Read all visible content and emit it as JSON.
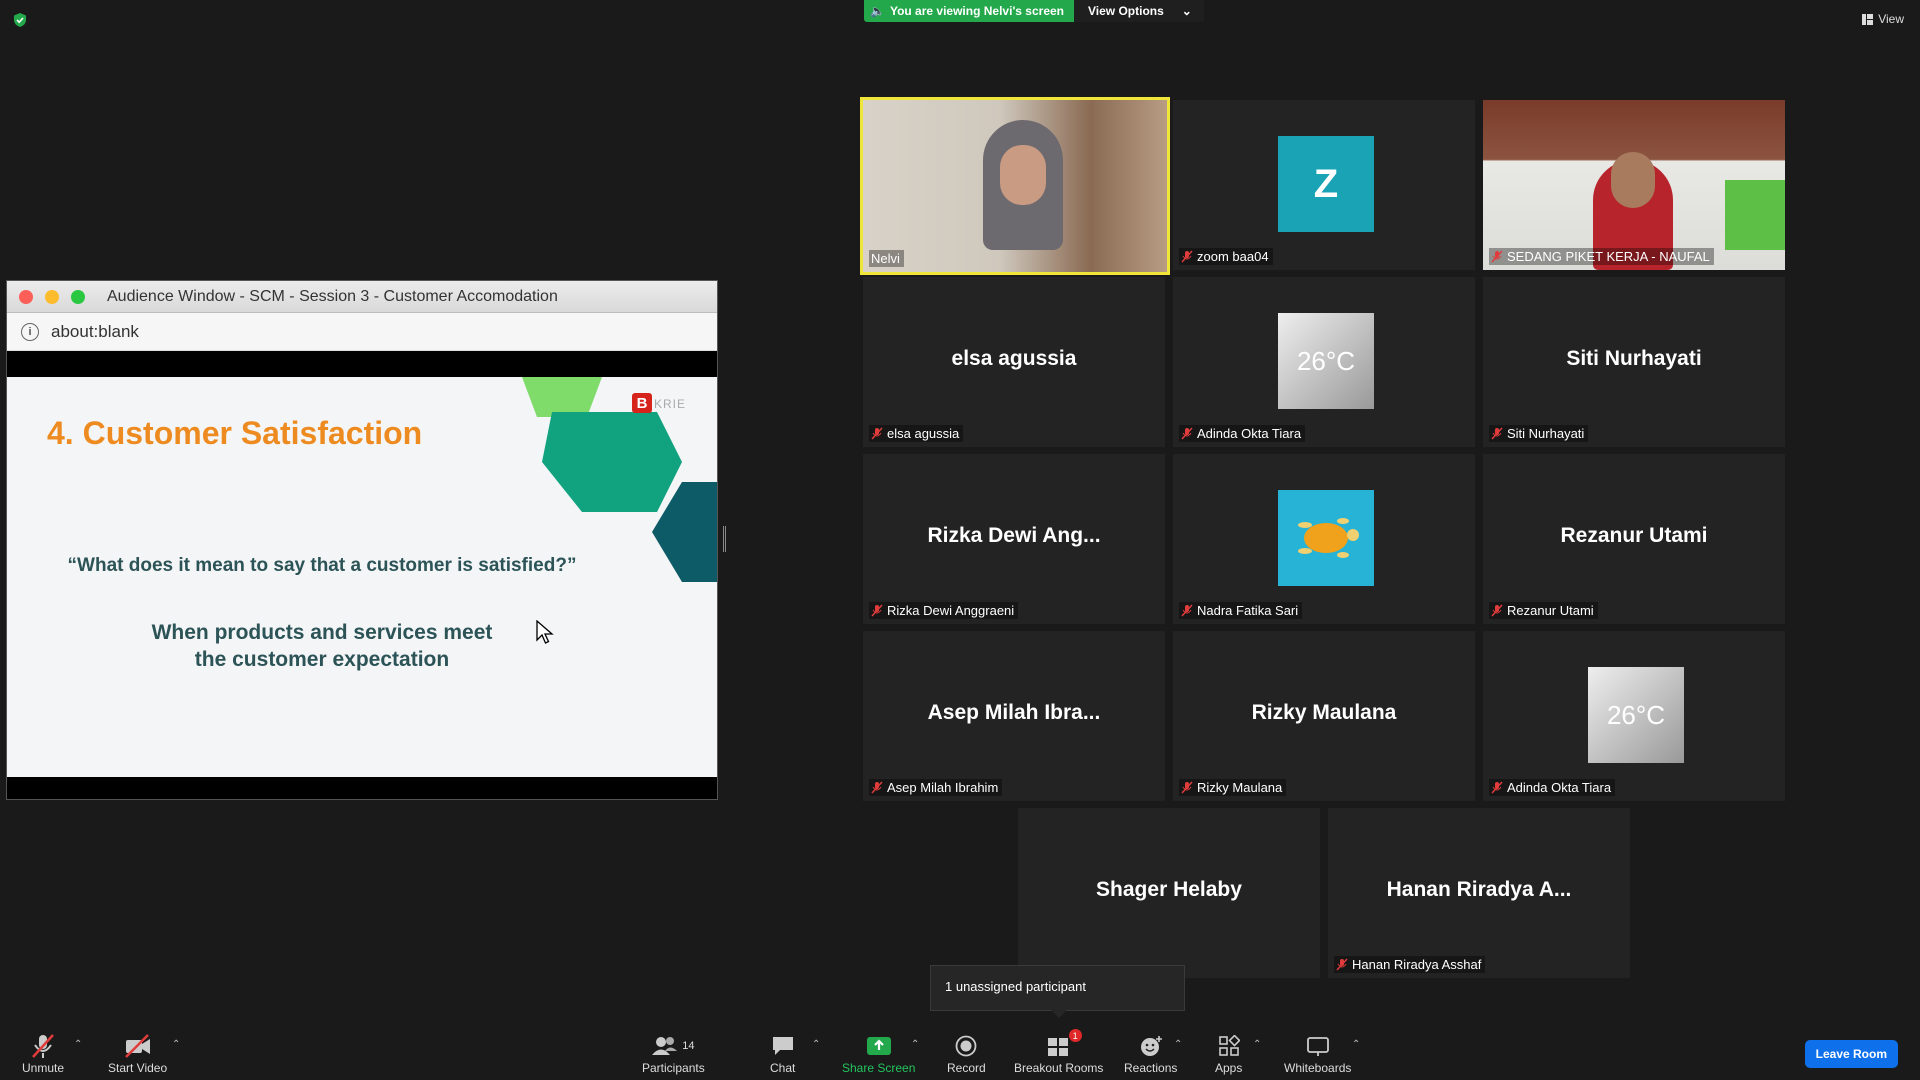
{
  "banner": {
    "viewing": "You are viewing Nelvi's screen",
    "options": "View Options"
  },
  "view_button": "View",
  "audience": {
    "title": "Audience Window - SCM - Session 3 - Customer Accomodation",
    "url": "about:blank",
    "slide": {
      "heading": "4. Customer Satisfaction",
      "question": "“What does it mean to say that a customer is satisfied?”",
      "answer_line1": "When products and services meet",
      "answer_line2": "the customer expectation",
      "logo_text": "KRIE"
    }
  },
  "tiles": [
    {
      "name": "Nelvi",
      "display": ""
    },
    {
      "name": "zoom baa04",
      "display": ""
    },
    {
      "name": "SEDANG PIKET KERJA - NAUFAL",
      "display": ""
    },
    {
      "name": "elsa agussia",
      "display": "elsa agussia"
    },
    {
      "name": "Adinda Okta Tiara",
      "display": ""
    },
    {
      "name": "Siti Nurhayati",
      "display": "Siti Nurhayati"
    },
    {
      "name": "Rizka Dewi Anggraeni",
      "display": "Rizka Dewi Ang..."
    },
    {
      "name": "Nadra Fatika Sari",
      "display": ""
    },
    {
      "name": "Rezanur Utami",
      "display": "Rezanur Utami"
    },
    {
      "name": "Asep Milah Ibrahim",
      "display": "Asep Milah Ibra..."
    },
    {
      "name": "Rizky Maulana",
      "display": "Rizky Maulana"
    },
    {
      "name": "Adinda Okta Tiara",
      "display": ""
    },
    {
      "name": "",
      "display": "Shager Helaby"
    },
    {
      "name": "Hanan Riradya Asshaf",
      "display": "Hanan Riradya A..."
    }
  ],
  "avatars": {
    "zoom_letter": "Z",
    "weather_text": "26°C"
  },
  "tooltip": "1 unassigned participant",
  "toolbar": {
    "unmute": "Unmute",
    "start_video": "Start Video",
    "participants": "Participants",
    "participant_count": "14",
    "chat": "Chat",
    "share_screen": "Share Screen",
    "record": "Record",
    "breakout": "Breakout Rooms",
    "breakout_badge": "1",
    "reactions": "Reactions",
    "apps": "Apps",
    "whiteboards": "Whiteboards",
    "leave": "Leave Room"
  },
  "colors": {
    "active_speaker": "#f0e63a",
    "share_green": "#23a94b",
    "leave_blue": "#0e71eb"
  }
}
